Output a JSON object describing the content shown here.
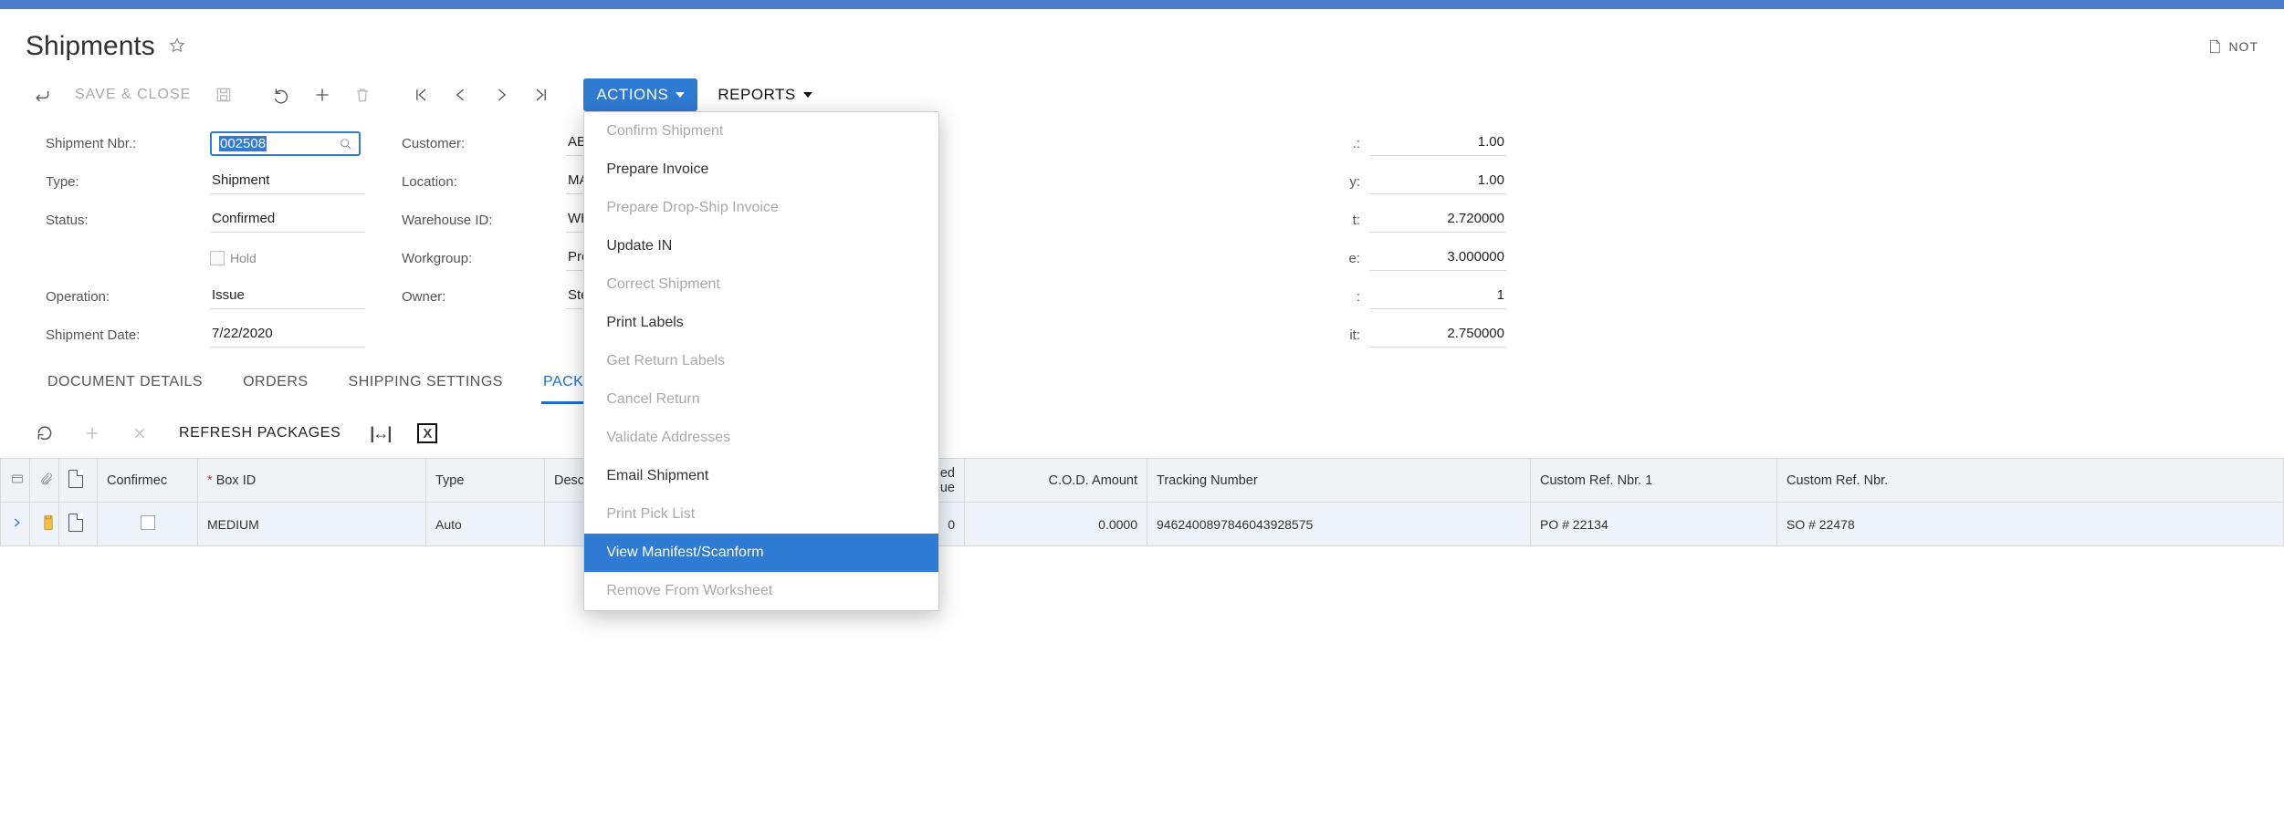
{
  "page": {
    "title": "Shipments",
    "notes_label": "NOT"
  },
  "toolbar": {
    "save_close": "SAVE & CLOSE",
    "actions_label": "ACTIONS",
    "reports_label": "REPORTS"
  },
  "form": {
    "shipment_nbr_label": "Shipment Nbr.:",
    "shipment_nbr_value": "002508",
    "type_label": "Type:",
    "type_value": "Shipment",
    "status_label": "Status:",
    "status_value": "Confirmed",
    "hold_label": "Hold",
    "operation_label": "Operation:",
    "operation_value": "Issue",
    "shipment_date_label": "Shipment Date:",
    "shipment_date_value": "7/22/2020",
    "customer_label": "Customer:",
    "customer_value": "ABARTENDE - USA Bartenc",
    "location_label": "Location:",
    "location_value": "MAIN - Primary Location",
    "warehouse_label": "Warehouse ID:",
    "warehouse_value": "WHOLESALE - Wholesale W",
    "workgroup_label": "Workgroup:",
    "workgroup_value": "Product Sales",
    "owner_label": "Owner:",
    "owner_value": "Steve Church"
  },
  "summary": {
    "r1": {
      "label": ".:",
      "value": "1.00"
    },
    "r2": {
      "label": "y:",
      "value": "1.00"
    },
    "r3": {
      "label": "t:",
      "value": "2.720000"
    },
    "r4": {
      "label": "e:",
      "value": "3.000000"
    },
    "r5": {
      "label": ":",
      "value": "1"
    },
    "r6": {
      "label": "it:",
      "value": "2.750000"
    }
  },
  "tabs": {
    "t1": "DOCUMENT DETAILS",
    "t2": "ORDERS",
    "t3": "SHIPPING SETTINGS",
    "t4": "PACKAGES"
  },
  "grid_toolbar": {
    "refresh_packages": "REFRESH PACKAGES"
  },
  "grid": {
    "columns": {
      "confirmed": "Confirmec",
      "box_id": "Box ID",
      "type": "Type",
      "description": "Description",
      "declared_partial": "ed\nue",
      "cod": "C.O.D. Amount",
      "tracking": "Tracking Number",
      "ref1": "Custom Ref. Nbr. 1",
      "ref2": "Custom Ref. Nbr."
    },
    "rows": [
      {
        "confirmed": false,
        "box_id": "MEDIUM",
        "type": "Auto",
        "description": "",
        "declared_partial": "0",
        "cod": "0.0000",
        "tracking": "9462400897846043928575",
        "ref1": "PO # 22134",
        "ref2": "SO # 22478"
      }
    ]
  },
  "actions_menu": {
    "items": [
      {
        "label": "Confirm Shipment",
        "enabled": false
      },
      {
        "label": "Prepare Invoice",
        "enabled": true
      },
      {
        "label": "Prepare Drop-Ship Invoice",
        "enabled": false
      },
      {
        "label": "Update IN",
        "enabled": true
      },
      {
        "label": "Correct Shipment",
        "enabled": false
      },
      {
        "label": "Print Labels",
        "enabled": true
      },
      {
        "label": "Get Return Labels",
        "enabled": false
      },
      {
        "label": "Cancel Return",
        "enabled": false
      },
      {
        "label": "Validate Addresses",
        "enabled": false
      },
      {
        "label": "Email Shipment",
        "enabled": true
      },
      {
        "label": "Print Pick List",
        "enabled": false
      },
      {
        "label": "View Manifest/Scanform",
        "enabled": true,
        "hover": true
      },
      {
        "label": "Remove From Worksheet",
        "enabled": false
      }
    ]
  }
}
